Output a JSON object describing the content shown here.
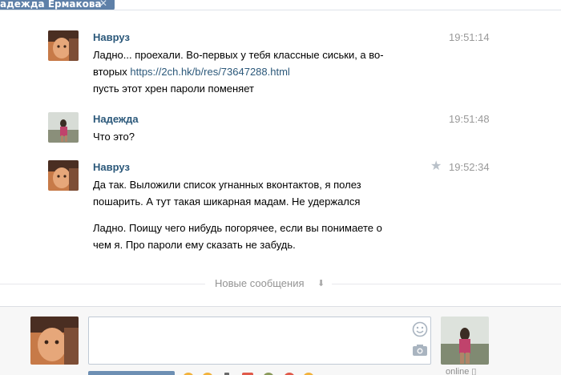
{
  "dialog_tab": {
    "name": "адежда Ермакова",
    "close_glyph": "✕"
  },
  "messages": [
    {
      "author": "Навруз",
      "time": "19:51:14",
      "lines": [
        "Ладно... проехали. Во-первых у тебя классные сиськи, а во-",
        "вторых",
        "пусть этот хрен пароли поменяет"
      ],
      "link": "https://2ch.hk/b/res/73647288.html"
    },
    {
      "author": "Надежда",
      "time": "19:51:48",
      "lines": [
        "Что это?"
      ]
    },
    {
      "author": "Навруз",
      "time": "19:52:34",
      "starred_icon": "star-icon",
      "lines": [
        "Да так. Выложили список угнанных вконтактов, я полез",
        "пошарить. А тут такая шикарная мадам. Не удержался",
        "Ладно. Поищу чего нибудь погорячее, если вы понимаете о",
        "чем я. Про пароли ему сказать не забудь."
      ]
    }
  ],
  "new_messages_divider": {
    "label": "Новые сообщения",
    "icon": "arrow-down-icon"
  },
  "composer": {
    "placeholder": "",
    "smile_icon": "smile-icon",
    "camera_icon": "camera-icon",
    "peer_status": "online"
  },
  "colors": {
    "link": "#2b587a",
    "author": "#2b587a",
    "time": "#999999",
    "tab": "#5e80a8"
  }
}
